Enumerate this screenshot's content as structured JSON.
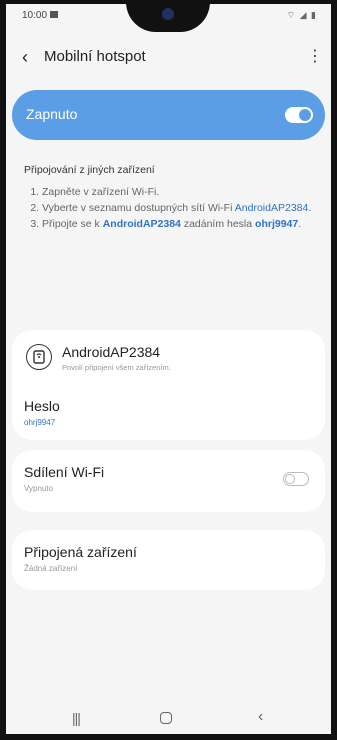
{
  "status_bar": {
    "time": "10:00",
    "right_icons": "⌔ ◢ ▮"
  },
  "app_bar": {
    "back_icon": "‹",
    "title": "Mobilní hotspot",
    "more_icon": "⋮"
  },
  "hotspot_toggle": {
    "label": "Zapnuto",
    "state": "on",
    "accent_color": "#5c9ee6"
  },
  "instructions": {
    "heading": "Připojování z jiných zařízení",
    "step1": "Zapněte v zařízení Wi-Fi.",
    "step2_prefix": "Vyberte v seznamu dostupných sítí Wi-Fi",
    "step2_network": "AndroidAP2384",
    "step2_suffix": ".",
    "step3_prefix": "Připojte se k",
    "step3_network": "AndroidAP2384",
    "step3_middle": "zadáním hesla",
    "step3_password": "ohrj9947",
    "step3_suffix": "."
  },
  "network": {
    "icon": "router-icon",
    "name": "AndroidAP2384",
    "subtitle": "Povolí připojení všem zařízením.",
    "password_label": "Heslo",
    "password_value": "ohrj9947"
  },
  "wifi_sharing": {
    "title": "Sdílení Wi-Fi",
    "subtitle": "Vypnuto",
    "state": "off"
  },
  "connected_devices": {
    "title": "Připojená zařízení",
    "subtitle": "Žádná zařízení"
  },
  "nav_bar": {
    "recent": "|||",
    "home": "home-icon",
    "back": "‹"
  }
}
